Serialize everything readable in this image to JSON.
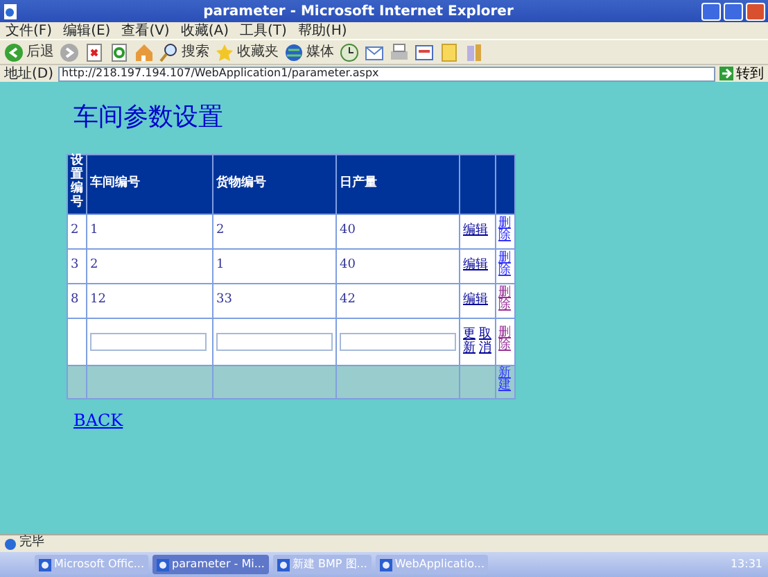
{
  "window": {
    "title": "parameter - Microsoft Internet Explorer"
  },
  "menu": [
    "文件(F)",
    "编辑(E)",
    "查看(V)",
    "收藏(A)",
    "工具(T)",
    "帮助(H)"
  ],
  "toolbar": [
    {
      "kind": "back",
      "label": "后退"
    },
    {
      "kind": "forward"
    },
    {
      "kind": "stop"
    },
    {
      "kind": "refresh"
    },
    {
      "kind": "home"
    },
    {
      "kind": "search",
      "label": "搜索"
    },
    {
      "kind": "favorites",
      "label": "收藏夹"
    },
    {
      "kind": "media",
      "label": "媒体"
    },
    {
      "kind": "history"
    },
    {
      "kind": "mail"
    },
    {
      "kind": "print"
    },
    {
      "kind": "edit"
    },
    {
      "kind": "note"
    },
    {
      "kind": "tool"
    }
  ],
  "address": {
    "label": "地址(D)",
    "url": "http://218.197.194.107/WebApplication1/parameter.aspx",
    "go": "转到"
  },
  "page": {
    "heading": "车间参数设置",
    "table": {
      "columns": [
        "设置编号",
        "车间编号",
        "货物编号",
        "日产量"
      ],
      "rows": [
        {
          "kind": "data",
          "cells": [
            "2",
            "1",
            "2",
            "40"
          ],
          "edit": "编辑",
          "delete": "删除",
          "delete_visited": false
        },
        {
          "kind": "data",
          "cells": [
            "3",
            "2",
            "1",
            "40"
          ],
          "edit": "编辑",
          "delete": "删除",
          "delete_visited": false
        },
        {
          "kind": "data",
          "cells": [
            "8",
            "12",
            "33",
            "42"
          ],
          "edit": "编辑",
          "delete": "删除",
          "delete_visited": true
        },
        {
          "kind": "editing",
          "update": "更新",
          "cancel": "取消",
          "delete": "删除",
          "delete_visited": true
        },
        {
          "kind": "footer",
          "new": "新建"
        }
      ]
    },
    "back_link": "BACK"
  },
  "status_bar": {
    "text": "完毕"
  },
  "taskbar": {
    "items": [
      {
        "label": "Microsoft Offic...",
        "selected": false
      },
      {
        "label": "parameter - Mi...",
        "selected": true
      },
      {
        "label": "新建 BMP 图...",
        "selected": false
      },
      {
        "label": "WebApplicatio...",
        "selected": false
      }
    ],
    "clock": "13:31"
  }
}
